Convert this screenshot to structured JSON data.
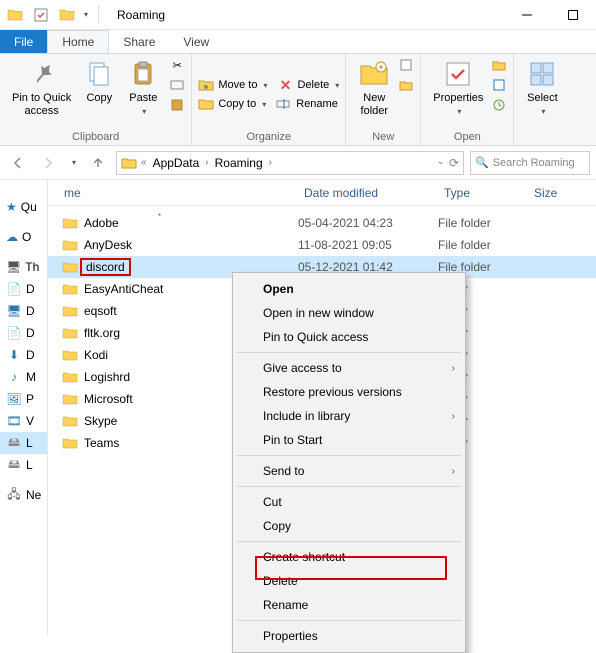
{
  "title": "Roaming",
  "tabs": {
    "file": "File",
    "home": "Home",
    "share": "Share",
    "view": "View"
  },
  "ribbon": {
    "clipboard": {
      "pin": "Pin to Quick\naccess",
      "copy": "Copy",
      "paste": "Paste",
      "label": "Clipboard"
    },
    "organize": {
      "moveto": "Move to",
      "copyto": "Copy to",
      "delete": "Delete",
      "rename": "Rename",
      "label": "Organize"
    },
    "new": {
      "newfolder": "New\nfolder",
      "label": "New"
    },
    "open": {
      "properties": "Properties",
      "label": "Open"
    },
    "select": {
      "select": "Select"
    }
  },
  "breadcrumb": {
    "seg1": "AppData",
    "seg2": "Roaming"
  },
  "search_placeholder": "Search Roaming",
  "nav": {
    "quick": "Qu",
    "onedrive_label": "O",
    "thispc_label": "Th",
    "item_d1": "D",
    "item_d2": "D",
    "item_d3": "D",
    "item_m": "M",
    "item_p": "P",
    "item_v": "V",
    "item_l": "L",
    "item_l2": "L",
    "item_ne": "Ne"
  },
  "columns": {
    "name": "me",
    "date": "Date modified",
    "type": "Type",
    "size": "Size"
  },
  "rows": [
    {
      "name": "Adobe",
      "date": "05-04-2021 04:23",
      "type": "File folder"
    },
    {
      "name": "AnyDesk",
      "date": "11-08-2021 09:05",
      "type": "File folder"
    },
    {
      "name": "discord",
      "date": "05-12-2021 01:42",
      "type": "File folder"
    },
    {
      "name": "EasyAntiCheat",
      "date": "",
      "type": "folder"
    },
    {
      "name": "eqsoft",
      "date": "",
      "type": "folder"
    },
    {
      "name": "fltk.org",
      "date": "",
      "type": "folder"
    },
    {
      "name": "Kodi",
      "date": "",
      "type": "folder"
    },
    {
      "name": "Logishrd",
      "date": "",
      "type": "folder"
    },
    {
      "name": "Microsoft",
      "date": "",
      "type": "folder"
    },
    {
      "name": "Skype",
      "date": "",
      "type": "folder"
    },
    {
      "name": "Teams",
      "date": "",
      "type": "folder"
    }
  ],
  "ctx": {
    "open": "Open",
    "open_new": "Open in new window",
    "pin_quick": "Pin to Quick access",
    "give_access": "Give access to",
    "restore": "Restore previous versions",
    "include": "Include in library",
    "pin_start": "Pin to Start",
    "send_to": "Send to",
    "cut": "Cut",
    "copy": "Copy",
    "shortcut": "Create shortcut",
    "delete": "Delete",
    "rename": "Rename",
    "properties": "Properties"
  }
}
